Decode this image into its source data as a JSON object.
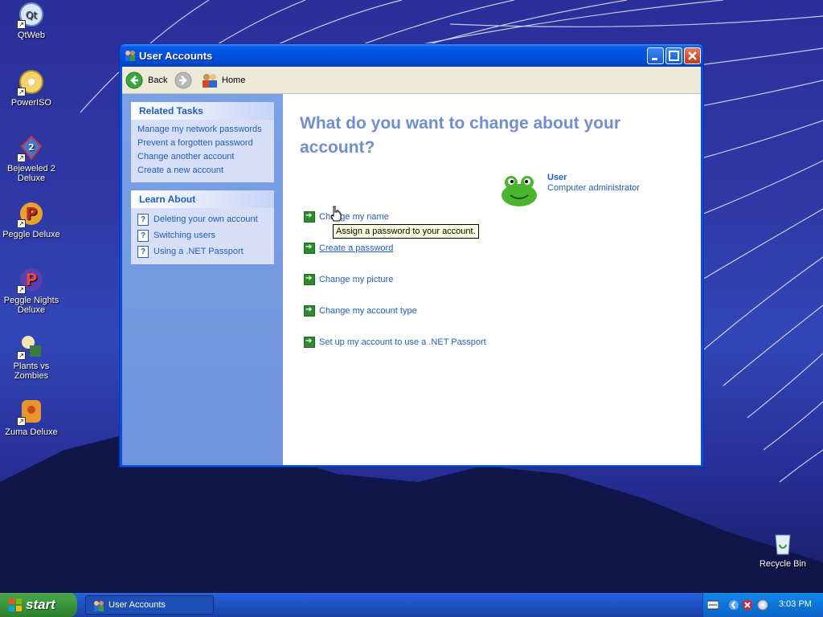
{
  "desktop": {
    "icons": [
      {
        "label": "QtWeb",
        "icon": "qtweb-icon"
      },
      {
        "label": "PowerISO",
        "icon": "poweriso-icon"
      },
      {
        "label": "Bejeweled 2 Deluxe",
        "icon": "bejeweled-icon"
      },
      {
        "label": "Peggle Deluxe",
        "icon": "peggle-icon"
      },
      {
        "label": "Peggle Nights Deluxe",
        "icon": "peggle-nights-icon"
      },
      {
        "label": "Plants vs Zombies",
        "icon": "plants-vs-zombies-icon"
      },
      {
        "label": "Zuma Deluxe",
        "icon": "zuma-icon"
      }
    ],
    "recycle_bin": "Recycle Bin"
  },
  "window": {
    "title": "User Accounts",
    "toolbar": {
      "back": "Back",
      "home": "Home"
    },
    "related_tasks": {
      "heading": "Related Tasks",
      "items": [
        "Manage my network passwords",
        "Prevent a forgotten password",
        "Change another account",
        "Create a new account"
      ]
    },
    "learn_about": {
      "heading": "Learn About",
      "items": [
        "Deleting your own account",
        "Switching users",
        "Using a .NET Passport"
      ]
    },
    "main": {
      "heading": "What do you want to change about your account?",
      "actions": [
        "Change my name",
        "Create a password",
        "Change my picture",
        "Change my account type",
        "Set up my account to use a .NET Passport"
      ],
      "tooltip": "Assign a password to your account."
    },
    "user": {
      "name": "User",
      "role": "Computer administrator"
    }
  },
  "taskbar": {
    "start": "start",
    "task": "User Accounts",
    "clock": "3:03 PM"
  },
  "colors": {
    "link": "#215dc6",
    "title_bar": "#0052e0",
    "taskpane": "#7aa1e6",
    "heading": "#6f8fcf"
  }
}
